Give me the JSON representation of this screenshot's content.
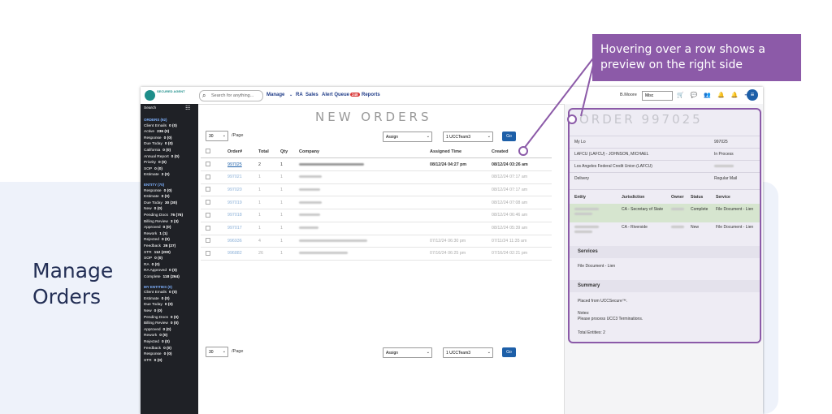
{
  "headline": {
    "line1": "Manage",
    "line2": "Orders"
  },
  "callout": {
    "text": "Hovering over a row shows a preview on the right side"
  },
  "topbar": {
    "logo_text": "SECURED AGENT",
    "search_placeholder": "Search for anything...",
    "nav": [
      "Manage",
      "RA",
      "Sales",
      "Alert Queue",
      "Reports"
    ],
    "alert_badge": "248",
    "user": "B.Moore",
    "user_select": "Misc"
  },
  "sidebar": {
    "search_label": "Search",
    "sections": [
      {
        "title": "ORDERS (92)",
        "items": [
          {
            "label": "Client Emails",
            "count": "0 (0)"
          },
          {
            "label": "Active",
            "count": "236 (0)"
          },
          {
            "label": "Response",
            "count": "0 (0)"
          },
          {
            "label": "Due Today",
            "count": "0 (0)"
          },
          {
            "label": "California",
            "count": "0 (0)"
          },
          {
            "label": "Annual Report",
            "count": "0 (0)"
          },
          {
            "label": "Priority",
            "count": "0 (0)"
          },
          {
            "label": "SOP",
            "count": "0 (0)"
          },
          {
            "label": "Estimate",
            "count": "3 (0)"
          }
        ]
      },
      {
        "title": "ENTITY (70)",
        "items": [
          {
            "label": "Response",
            "count": "0 (0)"
          },
          {
            "label": "Estimate",
            "count": "0 (0)"
          },
          {
            "label": "Due Today",
            "count": "30 (30)"
          },
          {
            "label": "New",
            "count": "0 (0)"
          },
          {
            "label": "Pending Docs",
            "count": "76 (76)"
          },
          {
            "label": "Billing Review",
            "count": "3 (3)"
          },
          {
            "label": "Approved",
            "count": "0 (0)"
          },
          {
            "label": "Rework",
            "count": "1 (1)"
          },
          {
            "label": "Rejected",
            "count": "0 (0)"
          },
          {
            "label": "Feedback",
            "count": "26 (27)"
          },
          {
            "label": "STR",
            "count": "112 (200)"
          },
          {
            "label": "SOP",
            "count": "0 (0)"
          },
          {
            "label": "RA",
            "count": "0 (0)"
          },
          {
            "label": "RA Approved",
            "count": "0 (0)"
          },
          {
            "label": "Complete",
            "count": "118 (264)"
          }
        ]
      },
      {
        "title": "MY ENTITIES (0)",
        "items": [
          {
            "label": "Client Emails",
            "count": "0 (0)"
          },
          {
            "label": "Estimate",
            "count": "0 (0)"
          },
          {
            "label": "Due Today",
            "count": "0 (0)"
          },
          {
            "label": "New",
            "count": "0 (0)"
          },
          {
            "label": "Pending Docs",
            "count": "0 (0)"
          },
          {
            "label": "Billing Review",
            "count": "0 (0)"
          },
          {
            "label": "Approved",
            "count": "0 (0)"
          },
          {
            "label": "Rework",
            "count": "0 (0)"
          },
          {
            "label": "Rejected",
            "count": "0 (0)"
          },
          {
            "label": "Feedback",
            "count": "0 (0)"
          },
          {
            "label": "Response",
            "count": "0 (0)"
          },
          {
            "label": "STR",
            "count": "0 (0)"
          }
        ]
      }
    ]
  },
  "main": {
    "title": "NEW ORDERS",
    "per_page_value": "30",
    "per_page_label": "/Page",
    "assign_label": "Assign",
    "team_value": "1 UCCTeam3",
    "go_label": "Go",
    "columns": [
      "Order#",
      "Total",
      "Qty",
      "Company",
      "Assigned Time",
      "Created"
    ],
    "rows": [
      {
        "order": "997025",
        "total": "2",
        "qty": "1",
        "assigned": "08/12/24 04:27 pm",
        "created": "08/12/24 03:26 am",
        "active": true
      },
      {
        "order": "997021",
        "total": "1",
        "qty": "1",
        "assigned": "",
        "created": "08/12/24 07:17 am",
        "active": false
      },
      {
        "order": "997020",
        "total": "1",
        "qty": "1",
        "assigned": "",
        "created": "08/12/24 07:17 am",
        "active": false
      },
      {
        "order": "997019",
        "total": "1",
        "qty": "1",
        "assigned": "",
        "created": "08/12/24 07:08 am",
        "active": false
      },
      {
        "order": "997018",
        "total": "1",
        "qty": "1",
        "assigned": "",
        "created": "08/12/24 06:46 am",
        "active": false
      },
      {
        "order": "997017",
        "total": "1",
        "qty": "1",
        "assigned": "",
        "created": "08/12/24 05:39 am",
        "active": false
      },
      {
        "order": "996936",
        "total": "4",
        "qty": "1",
        "assigned": "07/12/24 06:30 pm",
        "created": "07/11/24 11:35 am",
        "active": false
      },
      {
        "order": "996882",
        "total": "26",
        "qty": "1",
        "assigned": "07/16/24 06:25 pm",
        "created": "07/16/24 02:21 pm",
        "active": false
      }
    ]
  },
  "panel": {
    "title": "ORDER 997025",
    "info": [
      {
        "left": "My Lo",
        "right": "997025"
      },
      {
        "left": "LAFCU (LAFCU) - JOHNSON, MICHAEL",
        "right": "In Process"
      },
      {
        "left": "Los Angeles Federal Credit Union (LAFCU)",
        "right": ""
      },
      {
        "left": "Delivery",
        "right": "Regular Mail"
      }
    ],
    "entity_columns": [
      "Entity",
      "Jurisdiction",
      "Owner",
      "Status",
      "Service"
    ],
    "entities": [
      {
        "jurisdiction": "CA - Secretary of State",
        "status": "Complete",
        "service": "File Document - Lien"
      },
      {
        "jurisdiction": "CA - Riverside",
        "status": "New",
        "service": "File Document - Lien"
      }
    ],
    "services_title": "Services",
    "services_item": "File Document - Lien",
    "summary_title": "Summary",
    "summary_placed": "Placed from UCCSecure™.",
    "summary_notes_label": "Notes:",
    "summary_notes": "Please process UCC3 Terminations.",
    "summary_total": "Total Entities: 2"
  }
}
